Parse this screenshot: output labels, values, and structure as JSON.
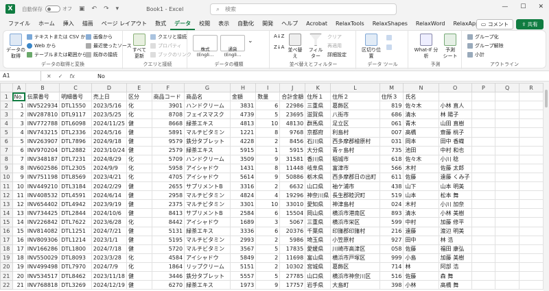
{
  "titlebar": {
    "app_icon": "X",
    "autosave_label": "自動保存",
    "autosave_state": "オフ",
    "doc_title": "Book1 - Excel",
    "search_placeholder": "検索",
    "comment_label": "コメント",
    "share_label": "共有"
  },
  "menu": [
    "ファイル",
    "ホーム",
    "挿入",
    "描画",
    "ページ レイアウト",
    "数式",
    "データ",
    "校閲",
    "表示",
    "自動化",
    "開発",
    "ヘルプ",
    "Acrobat",
    "RelaxTools",
    "RelaxShapes",
    "RelaxWord",
    "RelaxApps"
  ],
  "active_menu": "データ",
  "ribbon": {
    "get_data": "データの\n取得",
    "text_csv": "テキストまたは CSV から",
    "web": "Web から",
    "table_range": "テーブルまたは範囲から",
    "images": "画像から",
    "recent": "最近使ったソース",
    "existing": "既存の接続",
    "group1": "データの取得と変換",
    "refresh_all": "すべて\n更新",
    "queries": "クエリと接続",
    "properties": "プロパティ",
    "workbook_links": "ブックのリンク",
    "group2": "クエリと接続",
    "stock": "株式 (Engli…",
    "currency": "通貨 (Engli…",
    "group3": "データの種類",
    "sort": "並べ替え",
    "filter": "フィルター",
    "clear": "クリア",
    "reapply": "再適用",
    "advanced": "詳細設定",
    "group4": "並べ替えとフィルター",
    "text_to_col": "区切り位置",
    "group5": "データ ツール",
    "whatif": "What-If 分析",
    "forecast": "予測\nシート",
    "group6": "予測",
    "group_btn": "グループ化",
    "ungroup_btn": "グループ解除",
    "subtotal": "小計",
    "group7": "アウトライン"
  },
  "formula": {
    "name_box": "A1",
    "fx": "fx",
    "value": "No"
  },
  "columns": [
    "A",
    "B",
    "C",
    "D",
    "E",
    "F",
    "G",
    "H",
    "I",
    "J",
    "K",
    "L",
    "M",
    "N",
    "O",
    "P",
    "Q",
    "R"
  ],
  "rows": [
    [
      "No",
      "伝票番号",
      "明細番号",
      "売上日",
      "区分",
      "商品コード",
      "商品名",
      "金額",
      "数量",
      "合計金額",
      "住所１",
      "住所２",
      "住所３",
      "氏名",
      "",
      "",
      "",
      ""
    ],
    [
      "1",
      "INV522934",
      "DTL1550",
      "2023/5/16",
      "化",
      "3901",
      "ハンドクリーム",
      "3831",
      "6",
      "22986",
      "三重県",
      "葛飾区",
      "819",
      "佐々木 ",
      "小林 直人",
      "",
      "",
      ""
    ],
    [
      "2",
      "INV287810",
      "DTL9117",
      "2023/5/25",
      "化",
      "8708",
      "フェイスマスク",
      "4739",
      "5",
      "23695",
      "滋賀県",
      "八街市",
      "686",
      "清水 ",
      "林 陽子",
      "",
      "",
      ""
    ],
    [
      "3",
      "INV772788",
      "DTL6098",
      "2024/11/25",
      "健",
      "8668",
      "緑茶エキス",
      "4813",
      "10",
      "48130",
      "群馬県",
      "足立区",
      "061",
      "青木 ",
      "山田 直樹",
      "",
      "",
      ""
    ],
    [
      "4",
      "INV743215",
      "DTL2336",
      "2024/5/16",
      "健",
      "5891",
      "マルチビタミン",
      "1221",
      "8",
      "9768",
      "京都府",
      "利島村",
      "007",
      "高橋 ",
      "齋藤 桃子",
      "",
      "",
      ""
    ],
    [
      "5",
      "INV263907",
      "DTL7896",
      "2024/9/18",
      "健",
      "9579",
      "鉄分タブレット",
      "4228",
      "2",
      "8456",
      "石川県",
      "西多摩郡檜原村",
      "031",
      "岡本 ",
      "田中 香織",
      "",
      "",
      ""
    ],
    [
      "6",
      "INV970204",
      "DTL2882",
      "2023/10/24",
      "健",
      "2579",
      "緑茶エキス",
      "5915",
      "1",
      "5915",
      "大分県",
      "青ヶ島村",
      "735",
      "池田 ",
      "中村 和也",
      "",
      "",
      ""
    ],
    [
      "7",
      "INV348187",
      "DTL7231",
      "2024/8/29",
      "化",
      "5709",
      "ハンドクリーム",
      "3509",
      "9",
      "31581",
      "香川県",
      "稲城市",
      "618",
      "佐々木 ",
      "小川 稔",
      "",
      "",
      ""
    ],
    [
      "8",
      "INV602586",
      "DTL2305",
      "2024/9/9",
      "化",
      "5958",
      "アイシャドウ",
      "1431",
      "8",
      "11448",
      "岐阜県",
      "富津市",
      "566",
      "木村 ",
      "佐藤 太郎",
      "",
      "",
      ""
    ],
    [
      "9",
      "INV751198",
      "DTL8569",
      "2023/4/21",
      "化",
      "4705",
      "アイシャドウ",
      "5614",
      "9",
      "50886",
      "栃木県",
      "西多摩郡日の出町",
      "611",
      "佐藤 ",
      "遠藤 くみ子",
      "",
      "",
      ""
    ],
    [
      "10",
      "INV449210",
      "DTL3184",
      "2024/2/29",
      "健",
      "2655",
      "サプリメントB",
      "3316",
      "2",
      "6632",
      "山口県",
      "袖ケ浦市",
      "438",
      "山下 ",
      "山本 明美",
      "",
      "",
      ""
    ],
    [
      "11",
      "INV408532",
      "DTL4591",
      "2024/6/14",
      "健",
      "2958",
      "マルチビタミン",
      "4824",
      "4",
      "19296",
      "神奈川県",
      "長生郡睦沢町",
      "519",
      "山本 ",
      "松本 舞",
      "",
      "",
      ""
    ],
    [
      "12",
      "INV654402",
      "DTL4942",
      "2023/9/19",
      "健",
      "2375",
      "マルチビタミン",
      "3301",
      "10",
      "33010",
      "愛知県",
      "神津島村",
      "024",
      "木村 ",
      "小川 加奈",
      "",
      "",
      ""
    ],
    [
      "13",
      "INV734425",
      "DTL2844",
      "2024/10/6",
      "健",
      "8413",
      "サプリメントB",
      "2584",
      "6",
      "15504",
      "岡山県",
      "横浜市港南区",
      "893",
      "清水 ",
      "小林 美樹",
      "",
      "",
      ""
    ],
    [
      "14",
      "INV226842",
      "DTL7622",
      "2023/6/28",
      "化",
      "8442",
      "アイシャドウ",
      "1689",
      "3",
      "5067",
      "三重県",
      "横浜市栄区",
      "599",
      "中村 ",
      "加藤 修平",
      "",
      "",
      ""
    ],
    [
      "15",
      "INV814082",
      "DTL1251",
      "2024/7/21",
      "健",
      "5131",
      "緑茶エキス",
      "3336",
      "6",
      "20376",
      "千葉県",
      "印旛郡印旛村",
      "216",
      "遠藤 ",
      "渡辺 明美",
      "",
      "",
      ""
    ],
    [
      "16",
      "INV809306",
      "DTL1214",
      "2023/1/1",
      "健",
      "5195",
      "マルチビタミン",
      "2993",
      "2",
      "5986",
      "埼玉県",
      "小笠原村",
      "927",
      "田中 ",
      "林 浩",
      "",
      "",
      ""
    ],
    [
      "17",
      "INV166286",
      "DTL1800",
      "2024/7/18",
      "健",
      "5720",
      "マルチビタミン",
      "3567",
      "5",
      "17835",
      "愛媛県",
      "川崎市高津区",
      "058",
      "佐藤 ",
      "福田 康弘",
      "",
      "",
      ""
    ],
    [
      "18",
      "INV550029",
      "DTL8093",
      "2023/3/28",
      "化",
      "4584",
      "アイシャドウ",
      "5849",
      "2",
      "11698",
      "富山県",
      "横浜市戸塚区",
      "999",
      "小島 ",
      "加藤 美樹",
      "",
      "",
      ""
    ],
    [
      "19",
      "INV499498",
      "DTL7970",
      "2024/7/9",
      "化",
      "1864",
      "リップクリーム",
      "5151",
      "2",
      "10302",
      "宮城県",
      "葛飾区",
      "714",
      "林 ",
      "阿部 浩",
      "",
      "",
      ""
    ],
    [
      "20",
      "INV534517",
      "DTL8462",
      "2023/11/18",
      "健",
      "3446",
      "鉄分タブレット",
      "5557",
      "5",
      "27785",
      "山口県",
      "横浜市神奈川区",
      "516",
      "佐藤 ",
      "森 舞",
      "",
      "",
      ""
    ],
    [
      "21",
      "INV768818",
      "DTL3269",
      "2024/12/19",
      "健",
      "6270",
      "緑茶エキス",
      "1973",
      "9",
      "17757",
      "岩手県",
      "大島町",
      "398",
      "小林 ",
      "高橋 舞",
      "",
      "",
      ""
    ]
  ]
}
